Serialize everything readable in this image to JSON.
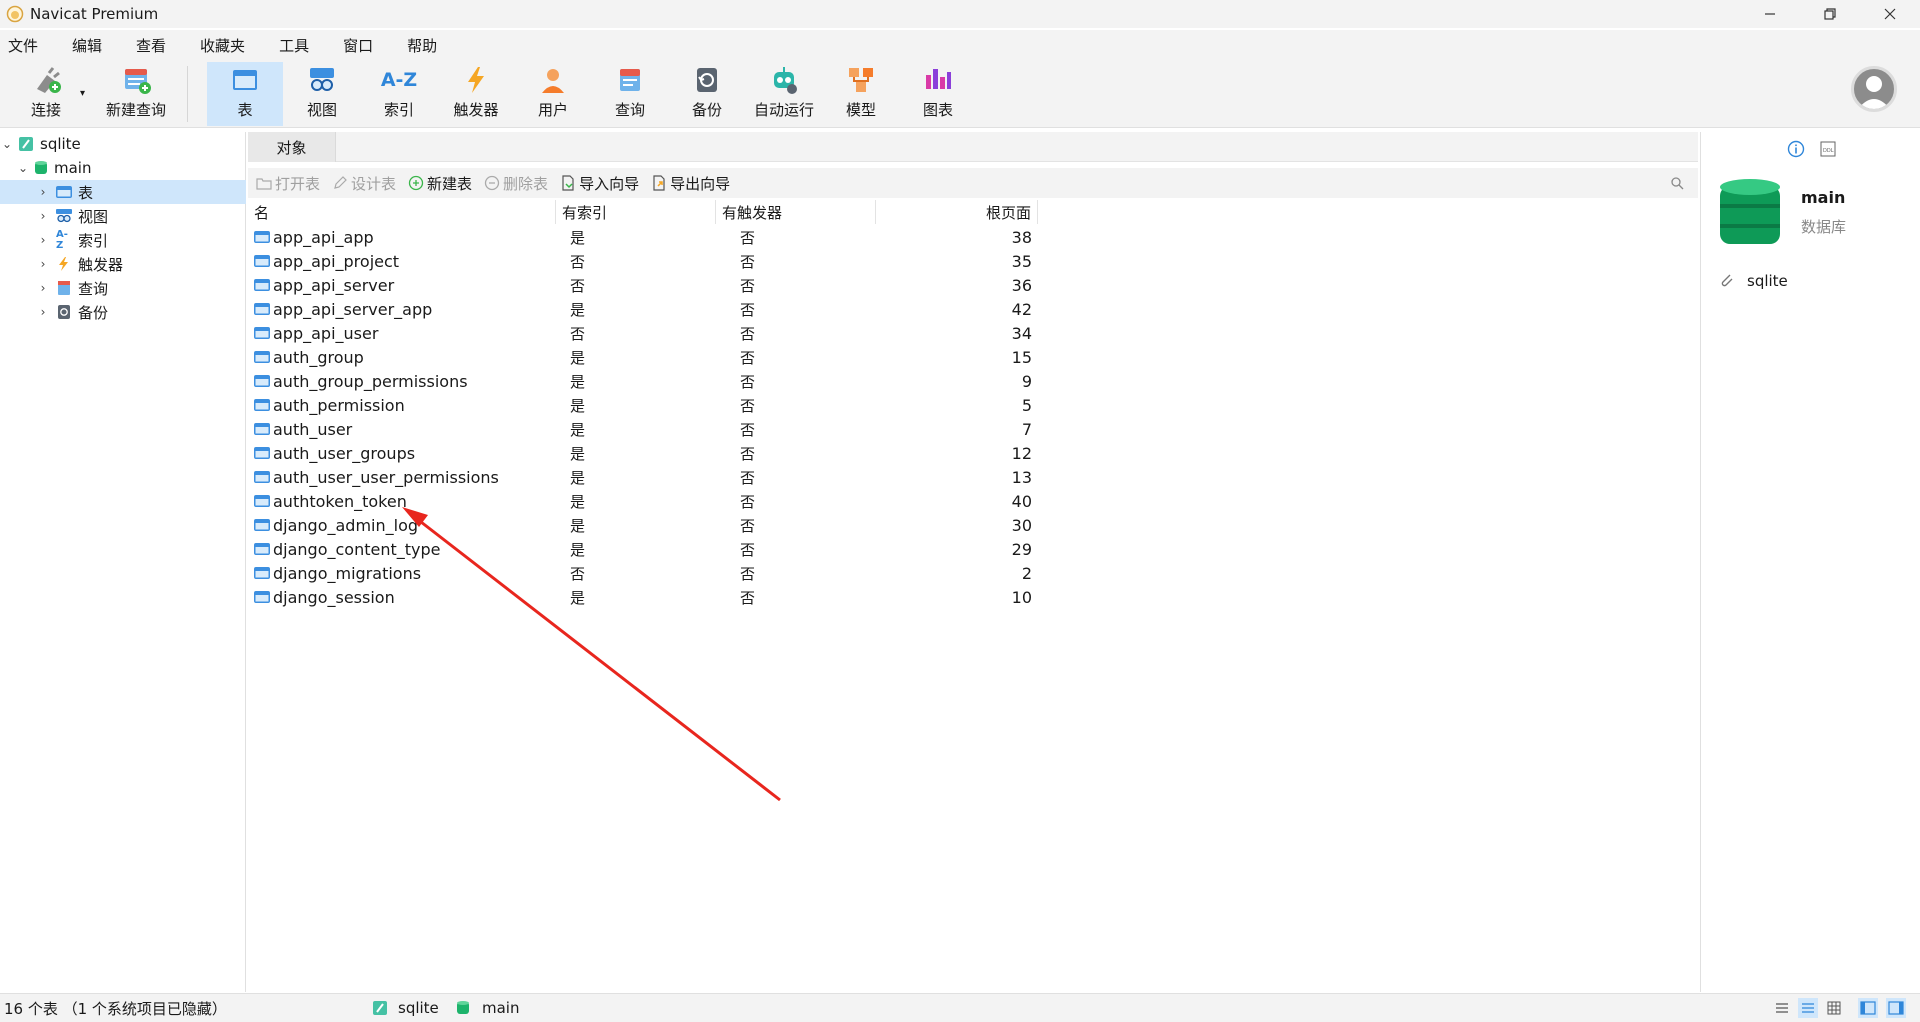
{
  "window": {
    "title": "Navicat Premium"
  },
  "menu": [
    "文件",
    "编辑",
    "查看",
    "收藏夹",
    "工具",
    "窗口",
    "帮助"
  ],
  "toolbar": {
    "connect": "连接",
    "new_query": "新建查询",
    "table": "表",
    "view": "视图",
    "index": "索引",
    "trigger": "触发器",
    "user": "用户",
    "query": "查询",
    "backup": "备份",
    "automation": "自动运行",
    "model": "模型",
    "chart": "图表",
    "index_icon_text": "A-Z"
  },
  "tree": {
    "connection": "sqlite",
    "database": "main",
    "items": [
      "表",
      "视图",
      "索引",
      "触发器",
      "查询",
      "备份"
    ]
  },
  "tab": {
    "label": "对象"
  },
  "object_toolbar": {
    "open_table": "打开表",
    "design_table": "设计表",
    "new_table": "新建表",
    "delete_table": "删除表",
    "import_wizard": "导入向导",
    "export_wizard": "导出向导"
  },
  "grid": {
    "columns": [
      "名",
      "有索引",
      "有触发器",
      "根页面"
    ],
    "rows": [
      {
        "name": "app_api_app",
        "has_index": "是",
        "has_trigger": "否",
        "root_page": "38"
      },
      {
        "name": "app_api_project",
        "has_index": "否",
        "has_trigger": "否",
        "root_page": "35"
      },
      {
        "name": "app_api_server",
        "has_index": "否",
        "has_trigger": "否",
        "root_page": "36"
      },
      {
        "name": "app_api_server_app",
        "has_index": "是",
        "has_trigger": "否",
        "root_page": "42"
      },
      {
        "name": "app_api_user",
        "has_index": "否",
        "has_trigger": "否",
        "root_page": "34"
      },
      {
        "name": "auth_group",
        "has_index": "是",
        "has_trigger": "否",
        "root_page": "15"
      },
      {
        "name": "auth_group_permissions",
        "has_index": "是",
        "has_trigger": "否",
        "root_page": "9"
      },
      {
        "name": "auth_permission",
        "has_index": "是",
        "has_trigger": "否",
        "root_page": "5"
      },
      {
        "name": "auth_user",
        "has_index": "是",
        "has_trigger": "否",
        "root_page": "7"
      },
      {
        "name": "auth_user_groups",
        "has_index": "是",
        "has_trigger": "否",
        "root_page": "12"
      },
      {
        "name": "auth_user_user_permissions",
        "has_index": "是",
        "has_trigger": "否",
        "root_page": "13"
      },
      {
        "name": "authtoken_token",
        "has_index": "是",
        "has_trigger": "否",
        "root_page": "40"
      },
      {
        "name": "django_admin_log",
        "has_index": "是",
        "has_trigger": "否",
        "root_page": "30"
      },
      {
        "name": "django_content_type",
        "has_index": "是",
        "has_trigger": "否",
        "root_page": "29"
      },
      {
        "name": "django_migrations",
        "has_index": "否",
        "has_trigger": "否",
        "root_page": "2"
      },
      {
        "name": "django_session",
        "has_index": "是",
        "has_trigger": "否",
        "root_page": "10"
      }
    ]
  },
  "info_panel": {
    "name": "main",
    "type": "数据库",
    "connection": "sqlite"
  },
  "status": {
    "summary": "16 个表 （1 个系统项目已隐藏）",
    "connection": "sqlite",
    "database": "main"
  },
  "colors": {
    "accent": "#cfe6fb",
    "db_green": "#1db36b",
    "annotation_arrow": "#e8261e"
  }
}
